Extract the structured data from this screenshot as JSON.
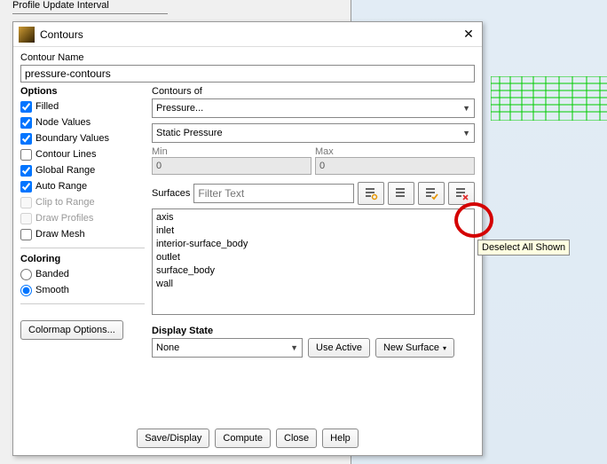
{
  "bg": {
    "profile_label": "Profile Update Interval"
  },
  "dialog": {
    "title": "Contours",
    "contour_name_label": "Contour Name",
    "contour_name_value": "pressure-contours",
    "options_header": "Options",
    "options": {
      "filled": "Filled",
      "node_values": "Node Values",
      "boundary_values": "Boundary Values",
      "contour_lines": "Contour Lines",
      "global_range": "Global Range",
      "auto_range": "Auto Range",
      "clip_to_range": "Clip to Range",
      "draw_profiles": "Draw Profiles",
      "draw_mesh": "Draw Mesh"
    },
    "coloring_header": "Coloring",
    "coloring": {
      "banded": "Banded",
      "smooth": "Smooth"
    },
    "colormap_btn": "Colormap Options...",
    "contours_of_label": "Contours of",
    "primary_var": "Pressure...",
    "secondary_var": "Static Pressure",
    "min_label": "Min",
    "max_label": "Max",
    "min_value": "0",
    "max_value": "0",
    "surfaces_label": "Surfaces",
    "filter_placeholder": "Filter Text",
    "surfaces": [
      "axis",
      "inlet",
      "interior-surface_body",
      "outlet",
      "surface_body",
      "wall"
    ],
    "display_state_label": "Display State",
    "display_state_value": "None",
    "use_active_btn": "Use Active",
    "new_surface_btn": "New Surface",
    "footer": {
      "save": "Save/Display",
      "compute": "Compute",
      "close": "Close",
      "help": "Help"
    }
  },
  "tooltip": "Deselect All Shown",
  "icons": {
    "filter_circle_color": "#e69500",
    "check_color": "#e69500",
    "x_color": "#e03030"
  }
}
